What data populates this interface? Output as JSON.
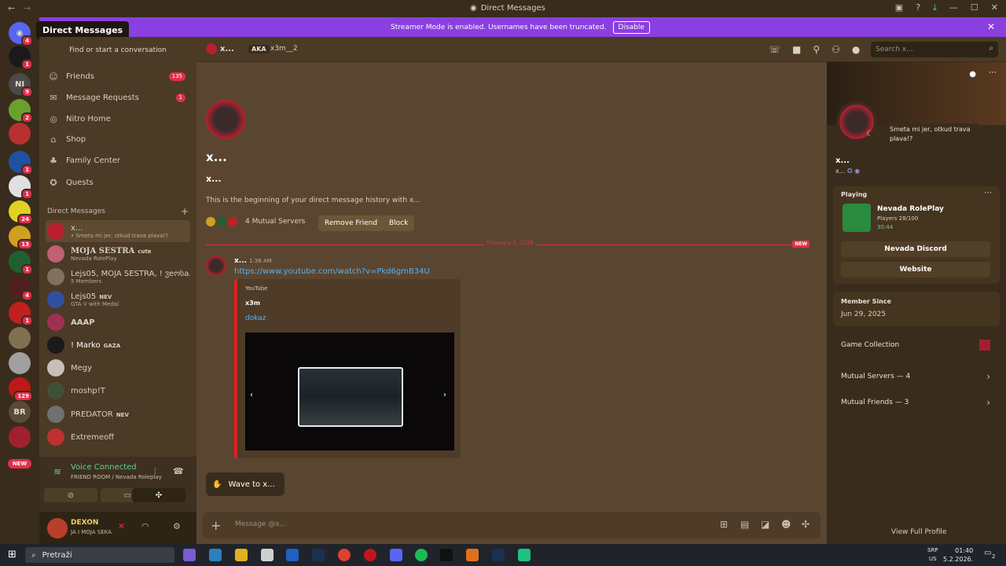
{
  "titlebar": {
    "title": "Direct Messages",
    "back_icon": "arrow-left-icon",
    "forward_icon": "arrow-right-icon"
  },
  "banner": {
    "text": "Streamer Mode is enabled. Usernames have been truncated.",
    "disable_label": "Disable",
    "color": "#8a3fe0"
  },
  "rail": {
    "tooltip": "Direct Messages",
    "badges": [
      "4",
      "1",
      "9",
      "2",
      "1",
      "1",
      "24",
      "13",
      "1",
      "4",
      "1",
      "129"
    ],
    "server_initials_1": "NI",
    "server_initials_2": "BR",
    "new_label": "NEW"
  },
  "sidebar": {
    "find_label": "Find or start a conversation",
    "nav": [
      {
        "label": "Friends",
        "count": "135"
      },
      {
        "label": "Message Requests",
        "count": "1"
      },
      {
        "label": "Nitro Home",
        "count": ""
      },
      {
        "label": "Shop",
        "count": ""
      },
      {
        "label": "Family Center",
        "count": ""
      },
      {
        "label": "Quests",
        "count": ""
      }
    ],
    "dm_header": "Direct Messages",
    "dms": [
      {
        "name": "x...",
        "sub": "• Smeta mi jer, otkud trava plava!?"
      },
      {
        "name": "MOJA SESTRA",
        "tag": "cute",
        "sub": "Nevada RolePlay"
      },
      {
        "name": "Lejs05, MOJA SESTRA, ! ჳeოსa...",
        "sub": "5 Members"
      },
      {
        "name": "Lejs05",
        "tag": "NEV",
        "sub": "GTA V with Medal"
      },
      {
        "name": "AAAP",
        "sub": ""
      },
      {
        "name": "! Marko",
        "tag": "GAZA",
        "sub": ""
      },
      {
        "name": "Megy",
        "sub": ""
      },
      {
        "name": "moshp!T",
        "sub": ""
      },
      {
        "name": "PREDATOR",
        "tag": "NEV",
        "sub": ""
      },
      {
        "name": "Extremeoff",
        "sub": ""
      }
    ]
  },
  "voice": {
    "status": "Voice Connected",
    "channel": "FRIEND ROOM / Nevada Roleplay"
  },
  "user": {
    "name": "DEXON",
    "status": "JA I MOJA SEKA"
  },
  "chat_header": {
    "name": "x...",
    "aka": "AKA",
    "alias": "x3m__2",
    "search_placeholder": "Search x..."
  },
  "chat": {
    "title": "x...",
    "subtitle": "x...",
    "intro": "This is the beginning of your direct message history with x...",
    "mutual_servers": "4 Mutual Servers",
    "remove_friend": "Remove Friend",
    "block": "Block",
    "divider_date": "February 5, 2026",
    "new_label": "NEW",
    "message": {
      "author": "x...",
      "time": "1:38 AM",
      "link": "https://www.youtube.com/watch?v=Pkd6gmB34U",
      "embed_provider": "YouTube",
      "embed_title": "x3m",
      "embed_desc": "dokaz"
    },
    "wave_label": "Wave to x...",
    "composer_placeholder": "Message @x..."
  },
  "profile": {
    "name": "x...",
    "tag": "x...",
    "custom_status": "Smeta mi jer, otkud trava plava!?",
    "playing_label": "Playing",
    "game_name": "Nevada RolePlay",
    "game_players": "Players 28/100",
    "game_time": "30:44",
    "discord_btn": "Nevada Discord",
    "website_btn": "Website",
    "member_since_label": "Member Since",
    "member_since": "Jun 29, 2025",
    "game_collection": "Game Collection",
    "mutual_servers": "Mutual Servers — 4",
    "mutual_friends": "Mutual Friends — 3",
    "view_full": "View Full Profile"
  },
  "taskbar": {
    "search": "Pretraži",
    "lang1": "SRP",
    "lang2": "US",
    "time": "01:40",
    "date": "5.2.2026.",
    "notif_count": "2"
  }
}
